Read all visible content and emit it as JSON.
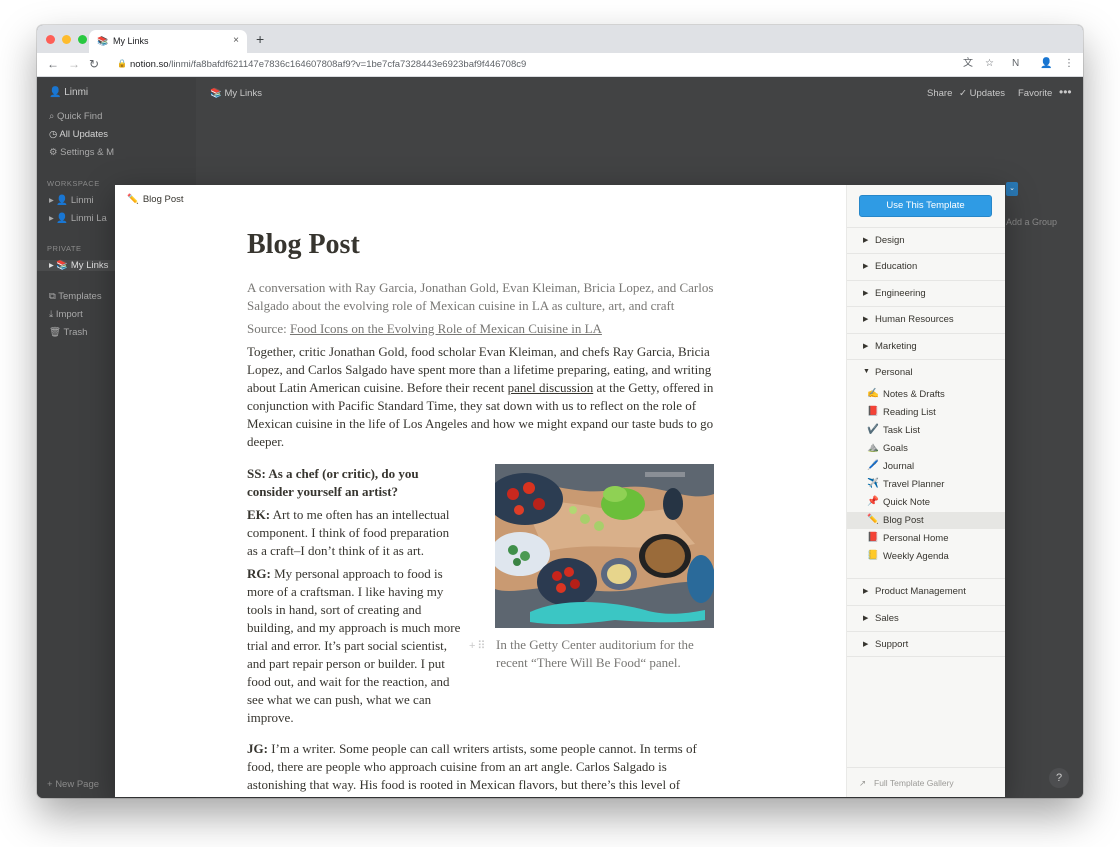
{
  "browser": {
    "tab_title": "My Links",
    "new_tab_label": "+",
    "url_host": "notion.so",
    "url_path": "/linmi/fa8bafdf621147e7836c164607808af9?v=1be7cfa7328443e6923baf9f446708c9",
    "tab_close": "×"
  },
  "sidebar": {
    "workspace_name": "Linmi",
    "quick_find": "Quick Find",
    "all_updates": "All Updates",
    "settings": "Settings & M",
    "workspace_header": "WORKSPACE",
    "workspace_items": [
      "Linmi",
      "Linmi La"
    ],
    "private_header": "PRIVATE",
    "private_items": [
      "My Links"
    ],
    "templates": "Templates",
    "import": "Import",
    "trash": "Trash",
    "new_page": "New Page"
  },
  "topbar": {
    "breadcrumb": "My Links",
    "share": "Share",
    "updates": "Updates",
    "favorite": "Favorite",
    "more": "•••"
  },
  "background": {
    "add_group": "Add a Group"
  },
  "help_label": "?",
  "template_preview": {
    "crumb": "Blog Post",
    "title": "Blog Post",
    "intro": "A conversation with Ray Garcia, Jonathan Gold, Evan Kleiman, Bricia Lopez, and Carlos Salgado about the evolving role of Mexican cuisine in LA as culture, art, and craft",
    "source_prefix": "Source: ",
    "source_link": "Food Icons on the Evolving Role of Mexican Cuisine in LA",
    "para1_a": "Together, critic Jonathan Gold, food scholar Evan Kleiman, and chefs Ray Garcia, Bricia Lopez, and Carlos Salgado have spent more than a lifetime preparing, eating, and writing about Latin American cuisine. Before their recent ",
    "para1_link": "panel discussion",
    "para1_b": " at the Getty, offered in conjunction with Pacific Standard Time, they sat down with us to reflect on the role of Mexican cuisine in the life of Los Angeles and how we might expand our taste buds to go deeper.",
    "q_ss": "SS: As a chef (or critic), do you consider yourself an artist?",
    "ek_label": "EK:",
    "ek_text": " Art to me often has an intellectual component. I think of food preparation as a craft–I don’t think of it as art.",
    "rg_label": "RG:",
    "rg_text": " My personal approach to food is more of a craftsman. I like having my tools in hand, sort of creating and building, and my approach is much more trial and error. It’s part social scientist, and part repair person or builder. I put food out, and wait for the reaction, and see what we can push, what we can improve.",
    "caption": "In the Getty Center auditorium for the recent “There Will Be Food“ panel.",
    "jg_label": "JG:",
    "jg_text": " I’m a writer. Some people can call writers artists, some people cannot. In terms of food, there are people who approach cuisine from an art angle. Carlos Salgado is astonishing that way. His food is rooted in Mexican flavors, but there’s this level of abstraction and innovation that brings it into a realm beyond."
  },
  "template_panel": {
    "use_button": "Use This Template",
    "categories_top": [
      "Design",
      "Education",
      "Engineering",
      "Human Resources",
      "Marketing"
    ],
    "personal_label": "Personal",
    "personal_items": [
      {
        "icon": "✍️",
        "label": "Notes & Drafts"
      },
      {
        "icon": "📕",
        "label": "Reading List"
      },
      {
        "icon": "✔️",
        "label": "Task List"
      },
      {
        "icon": "⛰️",
        "label": "Goals"
      },
      {
        "icon": "🖊️",
        "label": "Journal"
      },
      {
        "icon": "✈️",
        "label": "Travel Planner"
      },
      {
        "icon": "📌",
        "label": "Quick Note"
      },
      {
        "icon": "✏️",
        "label": "Blog Post"
      },
      {
        "icon": "📕",
        "label": "Personal Home"
      },
      {
        "icon": "📒",
        "label": "Weekly Agenda"
      }
    ],
    "selected": "Blog Post",
    "categories_bottom": [
      "Product Management",
      "Sales",
      "Support"
    ],
    "gallery_link": "Full Template Gallery"
  }
}
